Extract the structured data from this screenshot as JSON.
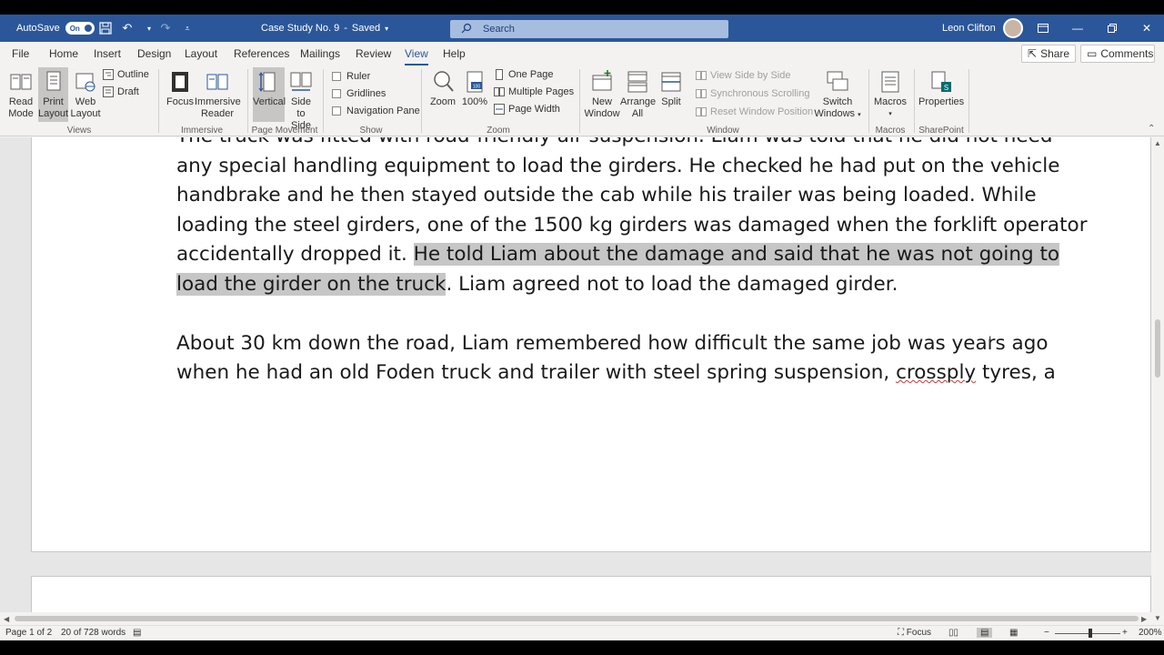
{
  "titlebar": {
    "autosave_label": "AutoSave",
    "autosave_state": "On",
    "doc_title": "Case Study No. 9",
    "save_status": "Saved",
    "search_placeholder": "Search",
    "user_name": "Leon Clifton",
    "bg_color": "#2b579a"
  },
  "tabs": [
    "File",
    "Home",
    "Insert",
    "Design",
    "Layout",
    "References",
    "Mailings",
    "Review",
    "View",
    "Help"
  ],
  "active_tab": "View",
  "share_label": "Share",
  "comments_label": "Comments",
  "ribbon": {
    "views": {
      "read_mode": [
        "Read",
        "Mode"
      ],
      "print_layout": [
        "Print",
        "Layout"
      ],
      "web_layout": [
        "Web",
        "Layout"
      ],
      "outline": "Outline",
      "draft": "Draft",
      "group": "Views"
    },
    "immersive": {
      "focus": "Focus",
      "reader": [
        "Immersive",
        "Reader"
      ],
      "group": "Immersive"
    },
    "page_movement": {
      "vertical": "Vertical",
      "side": [
        "Side",
        "to Side"
      ],
      "group": "Page Movement"
    },
    "show": {
      "ruler": "Ruler",
      "gridlines": "Gridlines",
      "nav_pane": "Navigation Pane",
      "group": "Show"
    },
    "zoom": {
      "zoom": "Zoom",
      "hundred": "100%",
      "one_page": "One Page",
      "multiple_pages": "Multiple Pages",
      "page_width": "Page Width",
      "group": "Zoom"
    },
    "window": {
      "new_window": [
        "New",
        "Window"
      ],
      "arrange_all": [
        "Arrange",
        "All"
      ],
      "split": "Split",
      "side_by_side": "View Side by Side",
      "sync_scroll": "Synchronous Scrolling",
      "reset_pos": "Reset Window Position",
      "switch": [
        "Switch",
        "Windows"
      ],
      "group": "Window"
    },
    "macros": {
      "label": "Macros",
      "group": "Macros"
    },
    "sharepoint": {
      "label": "Properties",
      "group": "SharePoint"
    }
  },
  "document": {
    "line0": "The truck was fitted with road-friendly air suspension. Liam was told that he did not need",
    "line1": "any special handling equipment to load the girders. He checked he had put on the vehicle",
    "line2": "handbrake and he then stayed outside the cab while his trailer was being loaded. While",
    "line3": "loading the steel girders, one of the 1500 kg girders was damaged when the forklift operator",
    "line4_a": "accidentally dropped it. ",
    "line4_hl": "He told Liam about the damage and said that he was not going to",
    "line5_hl": "load the girder on the truck",
    "line5_b": ". Liam agreed not to load the damaged girder.",
    "line6": "About 30 km down the road, Liam remembered how difficult the same job was years ago",
    "line7_a": "when he had an old Foden truck and trailer with steel spring suspension, ",
    "line7_sq": "crossply",
    "line7_b": " tyres, a"
  },
  "status": {
    "page": "Page 1 of 2",
    "words": "20 of 728 words",
    "focus": "Focus",
    "zoom": "200%"
  }
}
